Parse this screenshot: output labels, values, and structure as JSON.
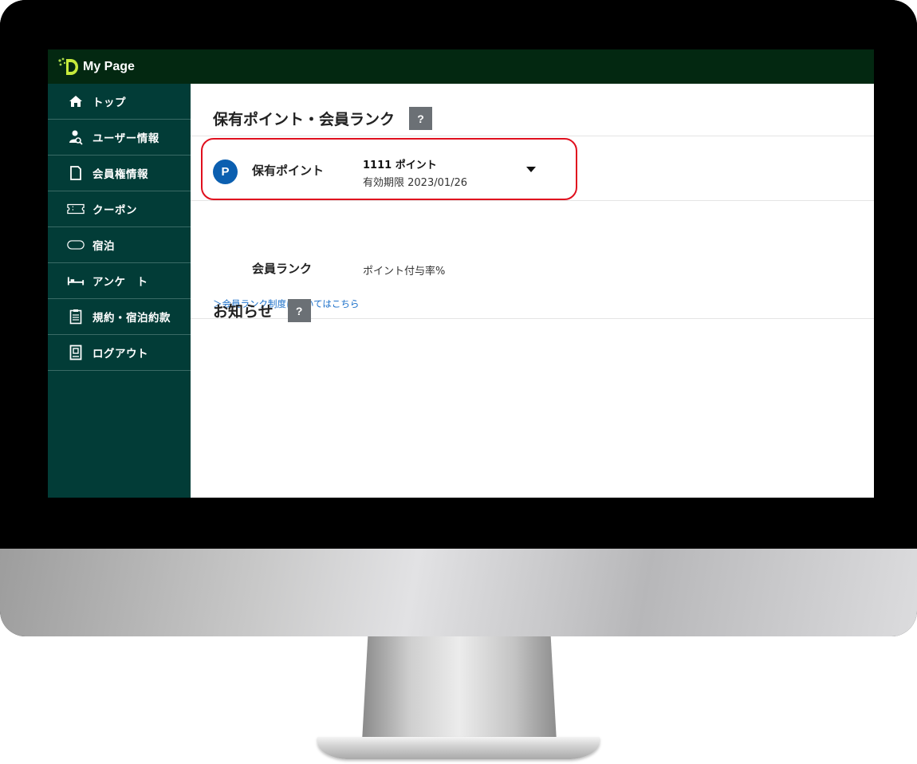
{
  "app": {
    "title": "My Page"
  },
  "sidebar": {
    "items": [
      {
        "label": "トップ",
        "icon": "home-icon"
      },
      {
        "label": "ユーザー情報",
        "icon": "user-search-icon"
      },
      {
        "label": "会員権情報",
        "icon": "card-icon"
      },
      {
        "label": "クーポン",
        "icon": "ticket-icon"
      },
      {
        "label": "宿泊",
        "icon": "capsule-icon"
      },
      {
        "label": "アンケ　ト",
        "icon": "bed-icon"
      },
      {
        "label": "規約・宿泊約款",
        "icon": "clipboard-icon"
      },
      {
        "label": "ログアウト",
        "icon": "door-icon"
      }
    ]
  },
  "main": {
    "points_section": {
      "title": "保有ポイント・会員ランク",
      "help_label": "?",
      "points_label": "保有ポイント",
      "points_badge": "P",
      "points_value": "1111 ポイント",
      "expiry": "有効期限 2023/01/26",
      "rank_label": "会員ランク",
      "rank_value": "ポイント付与率%",
      "rank_link": "＞会員ランク制度についてはこちら"
    },
    "news_section": {
      "title": "お知らせ",
      "help_label": "?"
    }
  },
  "colors": {
    "topbar": "#032811",
    "sidebar": "#023c37",
    "highlight": "#e0101e",
    "badge": "#0b5fb0",
    "link": "#1a6fc9"
  }
}
